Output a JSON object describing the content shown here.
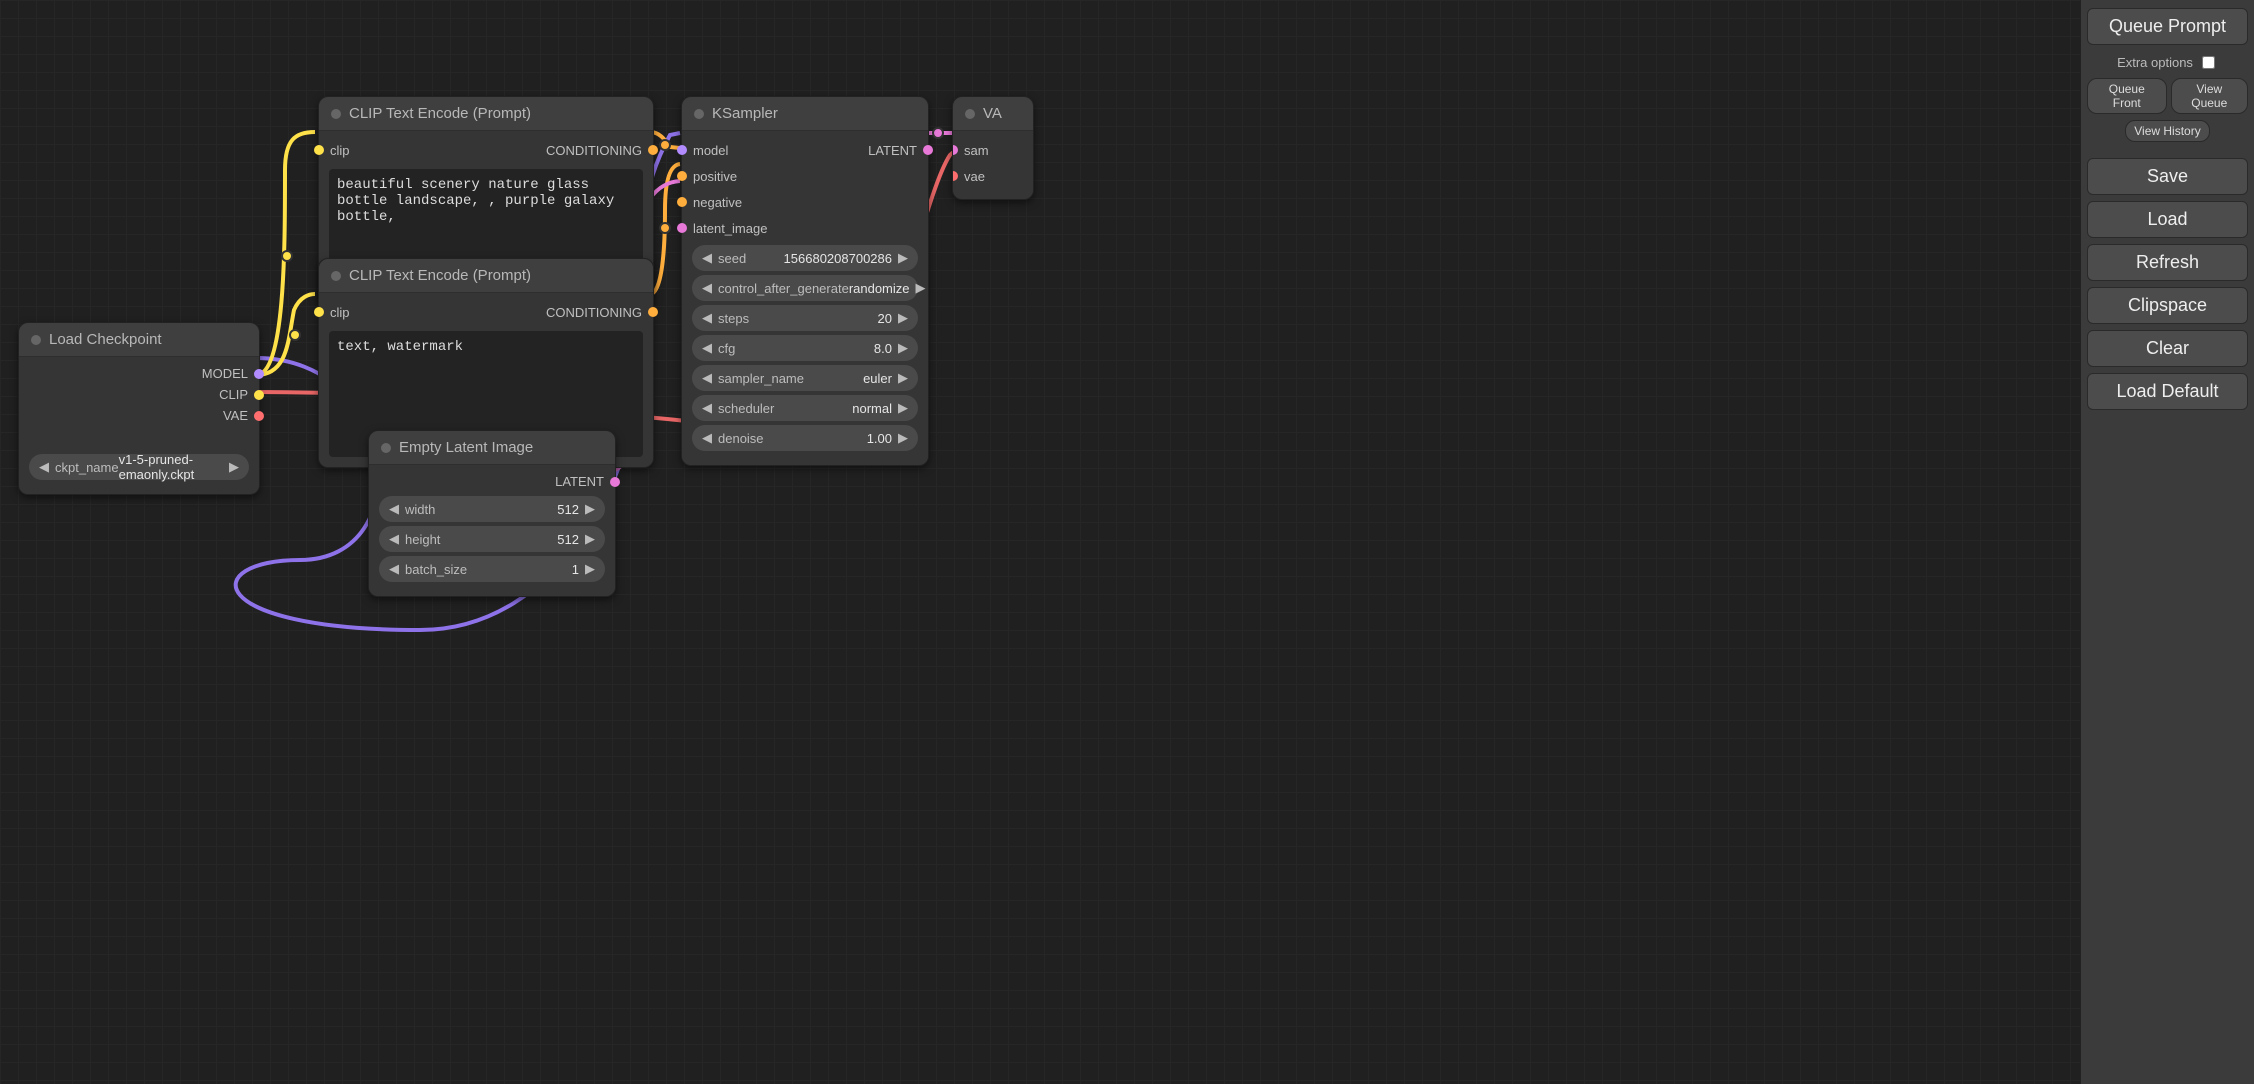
{
  "panel": {
    "queue_prompt": "Queue Prompt",
    "extra_options": "Extra options",
    "queue_front": "Queue Front",
    "view_queue": "View Queue",
    "view_history": "View History",
    "save": "Save",
    "load": "Load",
    "refresh": "Refresh",
    "clipspace": "Clipspace",
    "clear": "Clear",
    "load_default": "Load Default"
  },
  "nodes": {
    "load_ckpt": {
      "title": "Load Checkpoint",
      "out_model": "MODEL",
      "out_clip": "CLIP",
      "out_vae": "VAE",
      "ckpt_label": "ckpt_name",
      "ckpt_value": "v1-5-pruned-emaonly.ckpt"
    },
    "clip1": {
      "title": "CLIP Text Encode (Prompt)",
      "in_clip": "clip",
      "out_cond": "CONDITIONING",
      "text": "beautiful scenery nature glass bottle landscape, , purple galaxy bottle,"
    },
    "clip2": {
      "title": "CLIP Text Encode (Prompt)",
      "in_clip": "clip",
      "out_cond": "CONDITIONING",
      "text": "text, watermark"
    },
    "empty_latent": {
      "title": "Empty Latent Image",
      "out_latent": "LATENT",
      "width_label": "width",
      "width_value": "512",
      "height_label": "height",
      "height_value": "512",
      "batch_label": "batch_size",
      "batch_value": "1"
    },
    "ksampler": {
      "title": "KSampler",
      "in_model": "model",
      "in_positive": "positive",
      "in_negative": "negative",
      "in_latent": "latent_image",
      "out_latent": "LATENT",
      "seed_label": "seed",
      "seed_value": "156680208700286",
      "cag_label": "control_after_generate",
      "cag_value": "randomize",
      "steps_label": "steps",
      "steps_value": "20",
      "cfg_label": "cfg",
      "cfg_value": "8.0",
      "sampler_label": "sampler_name",
      "sampler_value": "euler",
      "scheduler_label": "scheduler",
      "scheduler_value": "normal",
      "denoise_label": "denoise",
      "denoise_value": "1.00"
    },
    "vae_decode": {
      "title": "VA",
      "in_samples": "sam",
      "in_vae": "vae"
    }
  }
}
